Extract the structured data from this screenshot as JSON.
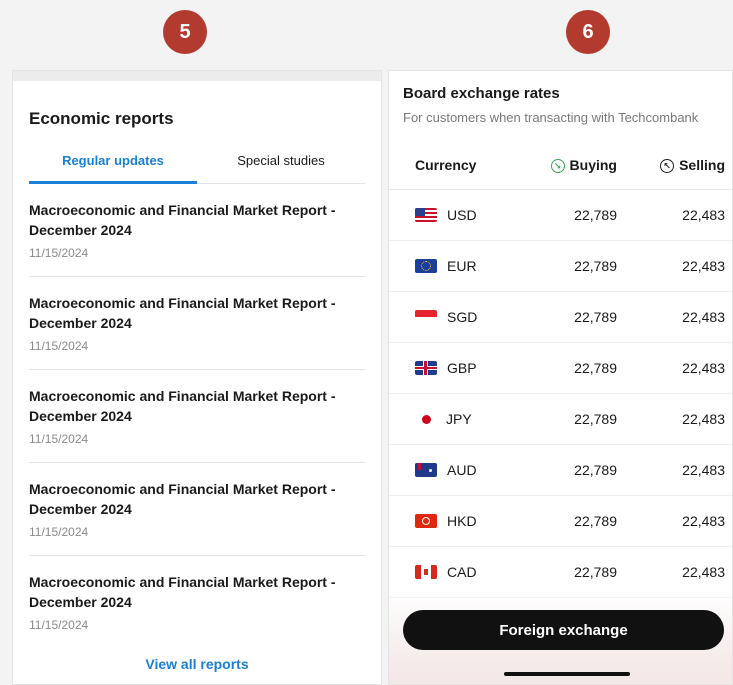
{
  "badges": {
    "left": "5",
    "right": "6"
  },
  "reports": {
    "title": "Economic reports",
    "tabs": [
      "Regular updates",
      "Special studies"
    ],
    "items": [
      {
        "title": "Macroeconomic and Financial Market Report - December 2024",
        "date": "11/15/2024"
      },
      {
        "title": "Macroeconomic and Financial Market Report - December 2024",
        "date": "11/15/2024"
      },
      {
        "title": "Macroeconomic and Financial Market Report - December 2024",
        "date": "11/15/2024"
      },
      {
        "title": "Macroeconomic and Financial Market Report - December 2024",
        "date": "11/15/2024"
      },
      {
        "title": "Macroeconomic and Financial Market Report - December 2024",
        "date": "11/15/2024"
      }
    ],
    "view_all": "View all reports"
  },
  "rates": {
    "title": "Board exchange rates",
    "subtitle": "For customers when transacting with Techcombank",
    "headers": {
      "currency": "Currency",
      "buying": "Buying",
      "selling": "Selling"
    },
    "rows": [
      {
        "code": "USD",
        "buying": "22,789",
        "selling": "22,483"
      },
      {
        "code": "EUR",
        "buying": "22,789",
        "selling": "22,483"
      },
      {
        "code": "SGD",
        "buying": "22,789",
        "selling": "22,483"
      },
      {
        "code": "GBP",
        "buying": "22,789",
        "selling": "22,483"
      },
      {
        "code": "JPY",
        "buying": "22,789",
        "selling": "22,483"
      },
      {
        "code": "AUD",
        "buying": "22,789",
        "selling": "22,483"
      },
      {
        "code": "HKD",
        "buying": "22,789",
        "selling": "22,483"
      },
      {
        "code": "CAD",
        "buying": "22,789",
        "selling": "22,483"
      }
    ],
    "fx_button": "Foreign exchange"
  },
  "colors": {
    "accent": "#1a7fd6",
    "badge": "#b23a2f",
    "buy_icon": "#3aa657"
  }
}
